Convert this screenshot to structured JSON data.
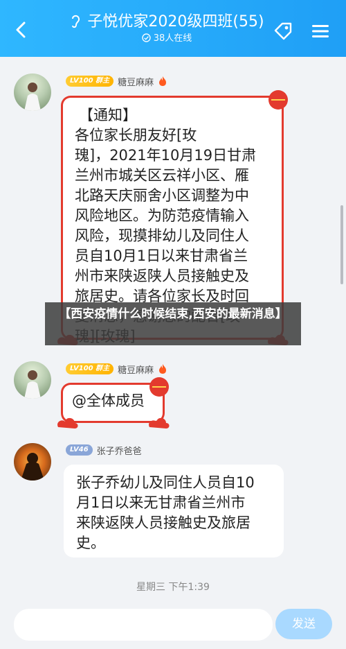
{
  "header": {
    "title": "子悦优家2020级四班(55)",
    "subtitle": "38人在线",
    "back_icon": "chevron-left-icon",
    "tag_icon": "tag-icon",
    "menu_icon": "hamburger-menu-icon"
  },
  "messages": [
    {
      "badge": "LV100 群主",
      "sender": "糖豆麻麻",
      "text_title": "【通知】",
      "text": "各位家长朋友好[玫\n瑰]，2021年10月19日甘肃\n兰州市城关区云祥小区、雁\n北路天庆丽舍小区调整为中\n风险地区。为防范疫情输入\n风险，现摸排幼儿及同住人\n员自10月1日以来甘肃省兰\n州市来陕返陕人员接触史及\n旅居史。请各位家长及时回\n复消息，感谢您的配合[玫\n瑰][玫瑰]"
    },
    {
      "badge": "LV100 群主",
      "sender": "糖豆麻麻",
      "text": "@全体成员"
    },
    {
      "badge": "LV46",
      "sender": "张子乔爸爸",
      "text": "张子乔幼儿及同住人员自10\n月1日以来无甘肃省兰州市\n来陕返陕人员接触史及旅居\n史。"
    }
  ],
  "timestamp": "星期三 下午1:39",
  "overlay_caption": "【西安疫情什么时候结束,西安的最新消息】",
  "input": {
    "placeholder": ""
  },
  "send_label": "发送",
  "colors": {
    "header": "#1f9ff6",
    "bubble_border": "#e33a2e",
    "send": "#a9d9ff"
  }
}
